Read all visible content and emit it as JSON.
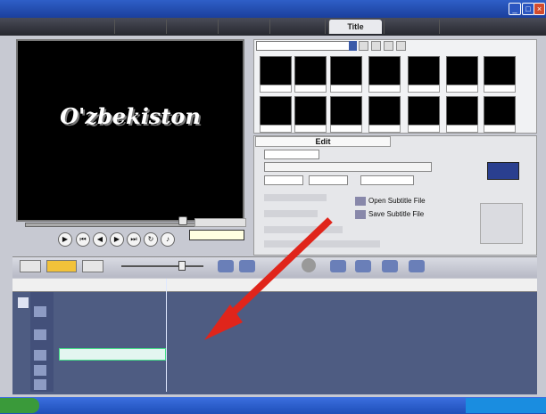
{
  "window": {
    "title": ""
  },
  "menu": [
    "",
    "",
    "",
    ""
  ],
  "steps": [
    {
      "label": "",
      "active": false
    },
    {
      "label": "",
      "active": false
    },
    {
      "label": "",
      "active": false
    },
    {
      "label": "",
      "active": false
    },
    {
      "label": "",
      "active": false
    },
    {
      "label": "Title",
      "active": true
    },
    {
      "label": "",
      "active": false
    },
    {
      "label": "",
      "active": false
    }
  ],
  "preview": {
    "text": "O'zbekiston"
  },
  "player": {
    "project_label": "",
    "tooltip": ""
  },
  "library": {
    "category": "",
    "captions": [
      "",
      "",
      "",
      "",
      "",
      "",
      "",
      "",
      "",
      "",
      "",
      "",
      "",
      ""
    ]
  },
  "options": {
    "tabs": [
      "Edit",
      ""
    ],
    "time": "",
    "font": "",
    "open_subtitle": "Open Subtitle File",
    "save_subtitle": "Save Subtitle File"
  },
  "timeline": {
    "ruler": [
      "",
      "",
      "",
      "",
      "",
      "",
      "",
      ""
    ],
    "clip_label": ""
  },
  "taskbar": {
    "items": [
      "",
      "",
      ""
    ]
  },
  "colors": {
    "accent": "#e0251b",
    "timeline": "#4e5c82"
  }
}
